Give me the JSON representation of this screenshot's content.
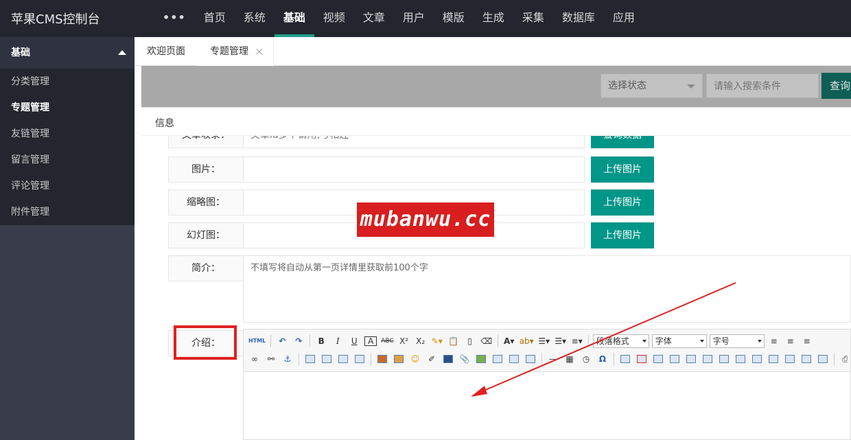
{
  "app": {
    "title": "苹果CMS控制台"
  },
  "topnav": {
    "more": "•••",
    "items": [
      "首页",
      "系统",
      "基础",
      "视频",
      "文章",
      "用户",
      "模版",
      "生成",
      "采集",
      "数据库",
      "应用"
    ],
    "active_index": 2
  },
  "sidebar": {
    "header": "基础",
    "items": [
      "分类管理",
      "专题管理",
      "友链管理",
      "留言管理",
      "评论管理",
      "附件管理"
    ],
    "active_index": 1
  },
  "tabs": {
    "welcome": "欢迎页面",
    "topic": "专题管理",
    "close": "×"
  },
  "filters": {
    "status_placeholder": "选择状态",
    "search_placeholder": "请输入搜索条件",
    "query_label": "查询"
  },
  "info": {
    "title": "信息"
  },
  "form": {
    "article_row": {
      "label": "文章收录：",
      "placeholder": "文章id多个请用,号相连",
      "button": "查询数据"
    },
    "image": {
      "label": "图片：",
      "button": "上传图片"
    },
    "thumb": {
      "label": "缩略图：",
      "button": "上传图片"
    },
    "slide": {
      "label": "幻灯图：",
      "button": "上传图片"
    },
    "summary": {
      "label": "简介：",
      "placeholder": "不填写将自动从第一页详情里获取前100个字"
    },
    "intro": {
      "label": "介绍："
    }
  },
  "editor": {
    "paragraph_select": "段落格式",
    "font_select": "字体",
    "size_select": "字号"
  },
  "watermark": {
    "text": "mubanwu.cc"
  },
  "colors": {
    "accent": "#009688",
    "topbar": "#23262e",
    "sidebar": "#393d49",
    "highlight_red": "#e02020"
  }
}
